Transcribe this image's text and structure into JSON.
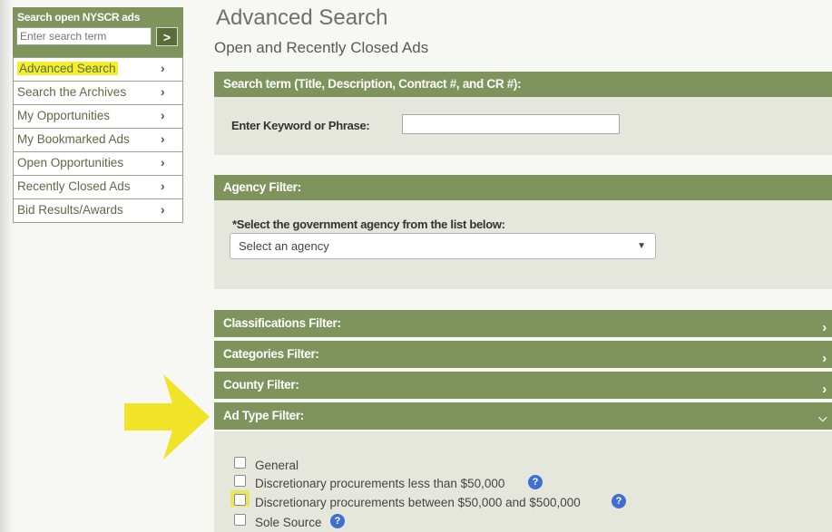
{
  "sidebar": {
    "search_title": "Search open NYSCR ads",
    "search_placeholder": "Enter search term",
    "go_glyph": ">",
    "items": [
      {
        "label": "Advanced Search"
      },
      {
        "label": "Search the Archives"
      },
      {
        "label": "My Opportunities"
      },
      {
        "label": "My Bookmarked Ads"
      },
      {
        "label": "Open Opportunities"
      },
      {
        "label": "Recently Closed Ads"
      },
      {
        "label": "Bid Results/Awards"
      }
    ]
  },
  "main": {
    "title": "Advanced Search",
    "subtitle": "Open and Recently Closed Ads",
    "search_term": {
      "header": "Search term (Title, Description, Contract #, and CR #):",
      "label": "Enter Keyword or Phrase:",
      "value": ""
    },
    "agency": {
      "header": "Agency Filter:",
      "label": "*Select the government agency from the list below:",
      "selected": "Select an agency"
    },
    "filters": [
      {
        "label": "Classifications Filter:",
        "state": "collapsed"
      },
      {
        "label": "Categories Filter:",
        "state": "collapsed"
      },
      {
        "label": "County Filter:",
        "state": "collapsed"
      },
      {
        "label": "Ad Type Filter:",
        "state": "expanded"
      }
    ],
    "ad_types": [
      {
        "label": "General",
        "help": false
      },
      {
        "label": "Discretionary procurements less than $50,000",
        "help": true
      },
      {
        "label": "Discretionary procurements between $50,000 and $500,000",
        "help": true
      },
      {
        "label": "Sole Source",
        "help": true
      }
    ]
  },
  "colors": {
    "accent": "#7f945c",
    "highlight": "#f5ee2e",
    "help_icon": "#3f6fcf"
  },
  "icons": {
    "chevron_right": "chevron-right-icon",
    "chevron_down": "chevron-down-icon",
    "help": "question-mark-icon",
    "annotation_arrow": "yellow-arrow-icon"
  }
}
